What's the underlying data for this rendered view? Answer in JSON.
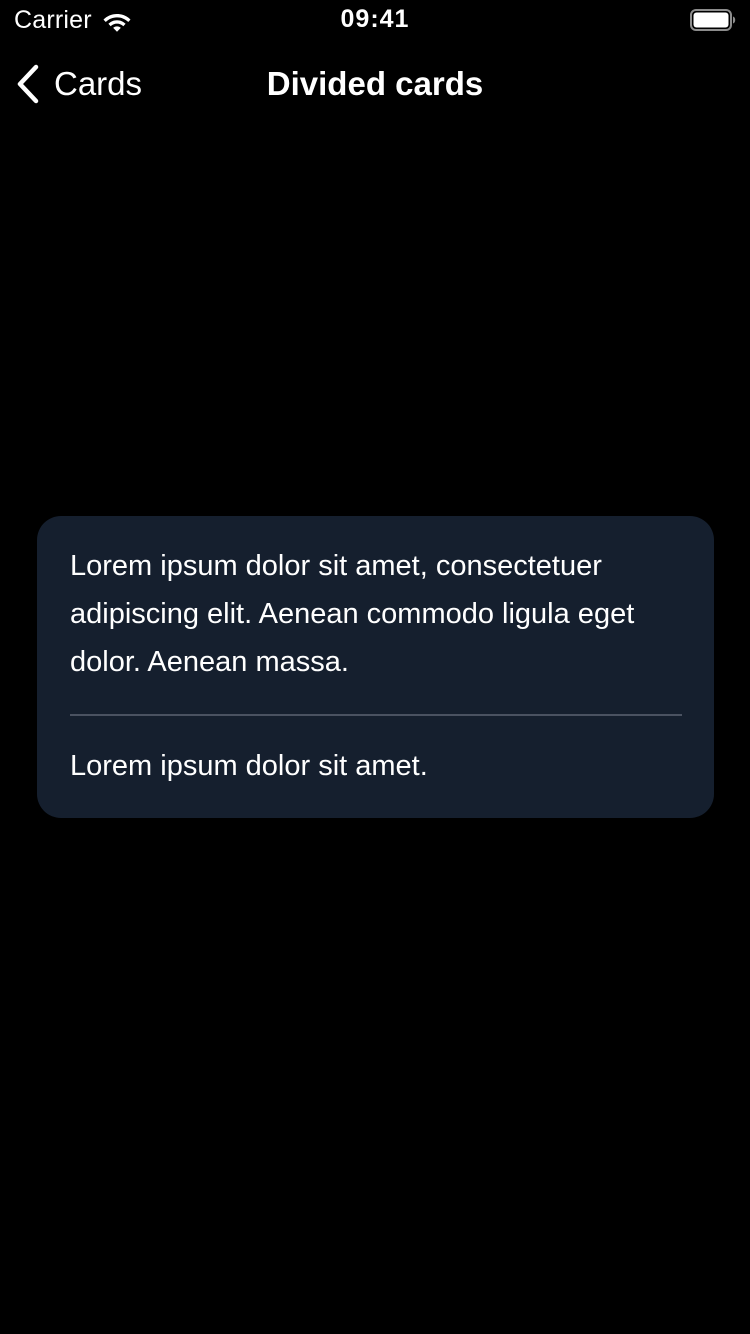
{
  "status_bar": {
    "carrier": "Carrier",
    "time": "09:41",
    "wifi_icon": "wifi-icon",
    "battery_icon": "battery-full-icon"
  },
  "nav": {
    "back_label": "Cards",
    "back_icon": "chevron-left-icon",
    "title": "Divided cards"
  },
  "card": {
    "body": "Lorem ipsum dolor sit amet, consectetuer adipiscing elit. Aenean commodo ligula eget dolor. Aenean massa.",
    "footer": "Lorem ipsum dolor sit amet."
  },
  "colors": {
    "background": "#000000",
    "card_background": "#151f2e",
    "divider": "#4a5261",
    "text": "#ffffff"
  }
}
